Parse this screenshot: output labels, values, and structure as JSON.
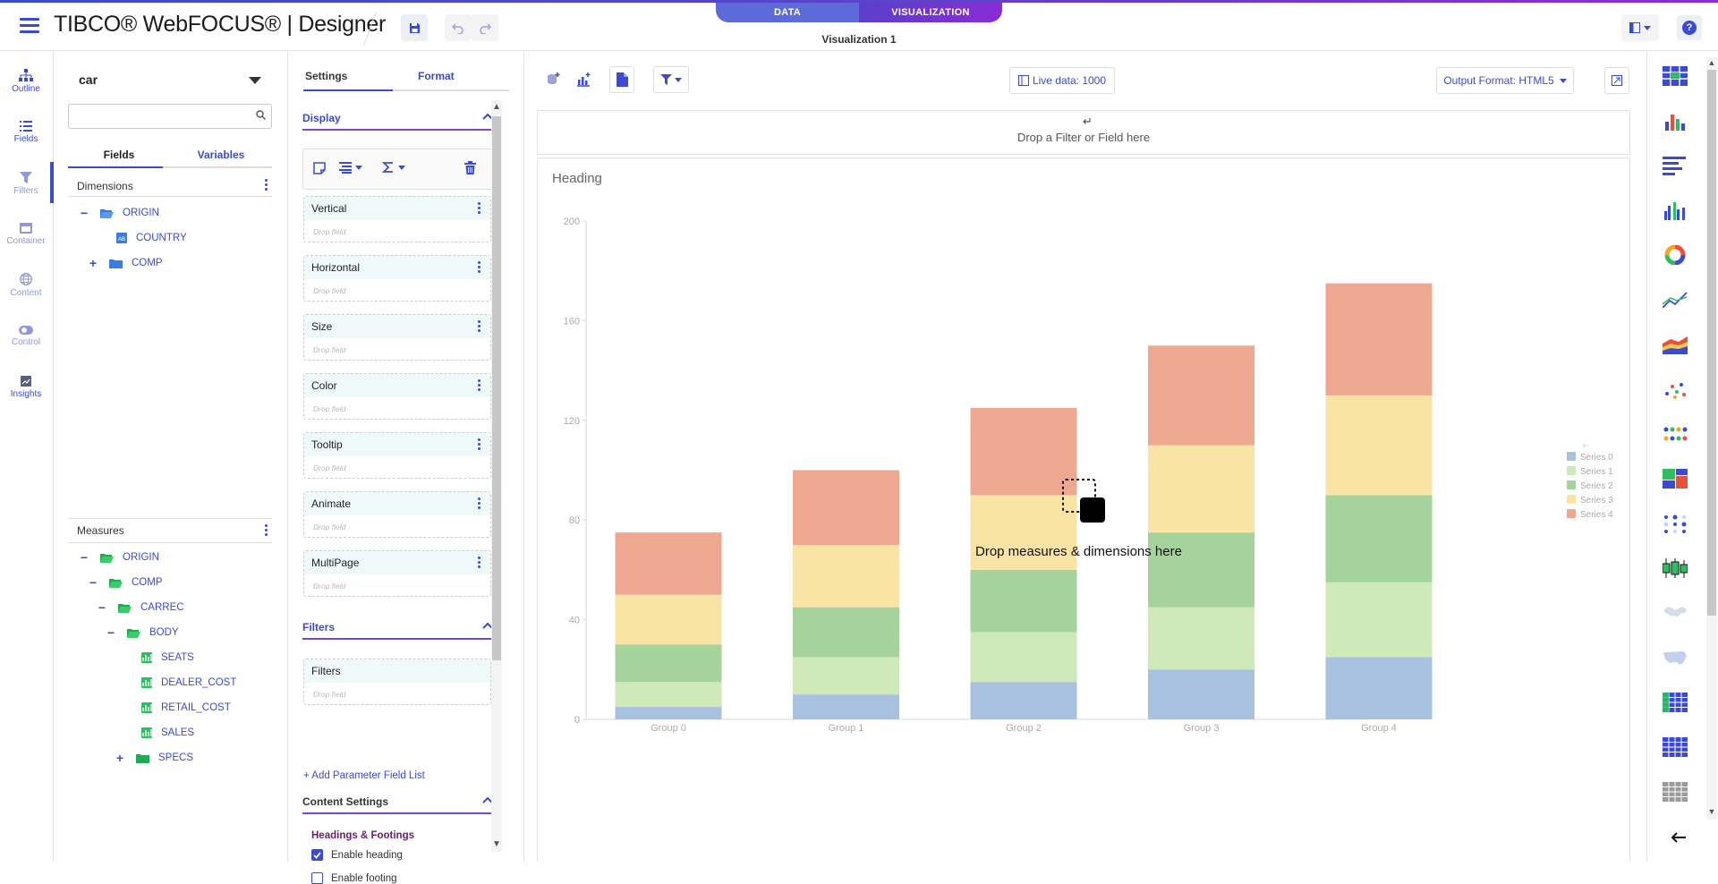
{
  "header": {
    "brand": "TIBCO® WebFOCUS® | Designer",
    "mode_tabs": [
      "DATA",
      "VISUALIZATION"
    ],
    "active_mode": "VISUALIZATION",
    "visualization_title": "Visualization 1",
    "help_label": "?"
  },
  "rail": {
    "items": [
      {
        "label": "Outline",
        "icon": "outline-icon"
      },
      {
        "label": "Fields",
        "icon": "fields-icon",
        "active": true
      },
      {
        "label": "Filters",
        "icon": "filter-icon"
      },
      {
        "label": "Container",
        "icon": "container-icon"
      },
      {
        "label": "Content",
        "icon": "globe-icon"
      },
      {
        "label": "Control",
        "icon": "toggle-icon"
      },
      {
        "label": "Insights",
        "icon": "insights-icon"
      }
    ]
  },
  "data_panel": {
    "datasource": "car",
    "search_placeholder": "",
    "tabs": [
      "Fields",
      "Variables"
    ],
    "dimensions_label": "Dimensions",
    "dimensions": [
      {
        "toggle": "−",
        "label": "ORIGIN",
        "type": "folder"
      },
      {
        "toggle": "",
        "label": "COUNTRY",
        "type": "alpha"
      },
      {
        "toggle": "+",
        "label": "COMP",
        "type": "folder"
      }
    ],
    "measures_label": "Measures",
    "measures": [
      {
        "toggle": "−",
        "label": "ORIGIN",
        "type": "folder"
      },
      {
        "toggle": "−",
        "label": "COMP",
        "type": "folder"
      },
      {
        "toggle": "−",
        "label": "CARREC",
        "type": "folder"
      },
      {
        "toggle": "−",
        "label": "BODY",
        "type": "folder"
      },
      {
        "toggle": "",
        "label": "SEATS",
        "type": "measure"
      },
      {
        "toggle": "",
        "label": "DEALER_COST",
        "type": "measure"
      },
      {
        "toggle": "",
        "label": "RETAIL_COST",
        "type": "measure"
      },
      {
        "toggle": "",
        "label": "SALES",
        "type": "measure"
      },
      {
        "toggle": "+",
        "label": "SPECS",
        "type": "folder"
      }
    ]
  },
  "settings": {
    "tabs": [
      "Settings",
      "Format"
    ],
    "display_label": "Display",
    "buckets": [
      {
        "label": "Vertical",
        "drop": "Drop field"
      },
      {
        "label": "Horizontal",
        "drop": "Drop field"
      },
      {
        "label": "Size",
        "drop": "Drop field"
      },
      {
        "label": "Color",
        "drop": "Drop field"
      },
      {
        "label": "Tooltip",
        "drop": "Drop field"
      },
      {
        "label": "Animate",
        "drop": "Drop field"
      },
      {
        "label": "MultiPage",
        "drop": "Drop field"
      }
    ],
    "filters_label": "Filters",
    "filters_bucket": {
      "label": "Filters",
      "drop": "Drop field"
    },
    "add_param": "+ Add Parameter Field List",
    "content_settings_label": "Content Settings",
    "headings_footings_label": "Headings & Footings",
    "enable_heading": {
      "label": "Enable heading",
      "checked": true
    },
    "enable_footing": {
      "label": "Enable footing",
      "checked": false
    }
  },
  "canvas": {
    "live_data": "Live data: 1000",
    "output_format": "Output Format: HTML5",
    "filter_drop": "Drop a Filter or Field here",
    "heading": "Heading",
    "drop_overlay": "Drop measures & dimensions here"
  },
  "chart_data": {
    "type": "bar",
    "stacked": true,
    "categories": [
      "Group 0",
      "Group 1",
      "Group 2",
      "Group 3",
      "Group 4"
    ],
    "series": [
      {
        "name": "Series 0",
        "values": [
          5,
          10,
          15,
          20,
          25
        ],
        "color": "#a8c1de"
      },
      {
        "name": "Series 1",
        "values": [
          10,
          15,
          20,
          25,
          30
        ],
        "color": "#d0e9b8"
      },
      {
        "name": "Series 2",
        "values": [
          15,
          20,
          25,
          30,
          35
        ],
        "color": "#a6d39c"
      },
      {
        "name": "Series 3",
        "values": [
          20,
          25,
          30,
          35,
          40
        ],
        "color": "#f9e3a5"
      },
      {
        "name": "Series 4",
        "values": [
          25,
          30,
          35,
          40,
          45
        ],
        "color": "#eea891"
      }
    ],
    "ylim": [
      0,
      200
    ],
    "yticks": [
      0,
      40,
      80,
      120,
      160,
      200
    ],
    "title": "Heading",
    "xlabel": "",
    "ylabel": "",
    "legend": "right"
  },
  "palette": {
    "items": [
      "table-chart-icon",
      "bar-chart-icon",
      "horizontal-bar-icon",
      "column-chart-icon",
      "ring-pie-icon",
      "line-chart-icon",
      "area-chart-icon",
      "scatter-icon",
      "bubble-icon",
      "treemap-icon",
      "matrix-icon",
      "boxplot-icon",
      "world-map-icon",
      "us-map-icon",
      "crosstab-icon",
      "grid-report-icon",
      "report-icon"
    ]
  },
  "colors": {
    "accent": "#3b4bd1",
    "accent_purple": "#7a47cc",
    "measure_green": "#2fbf62"
  }
}
